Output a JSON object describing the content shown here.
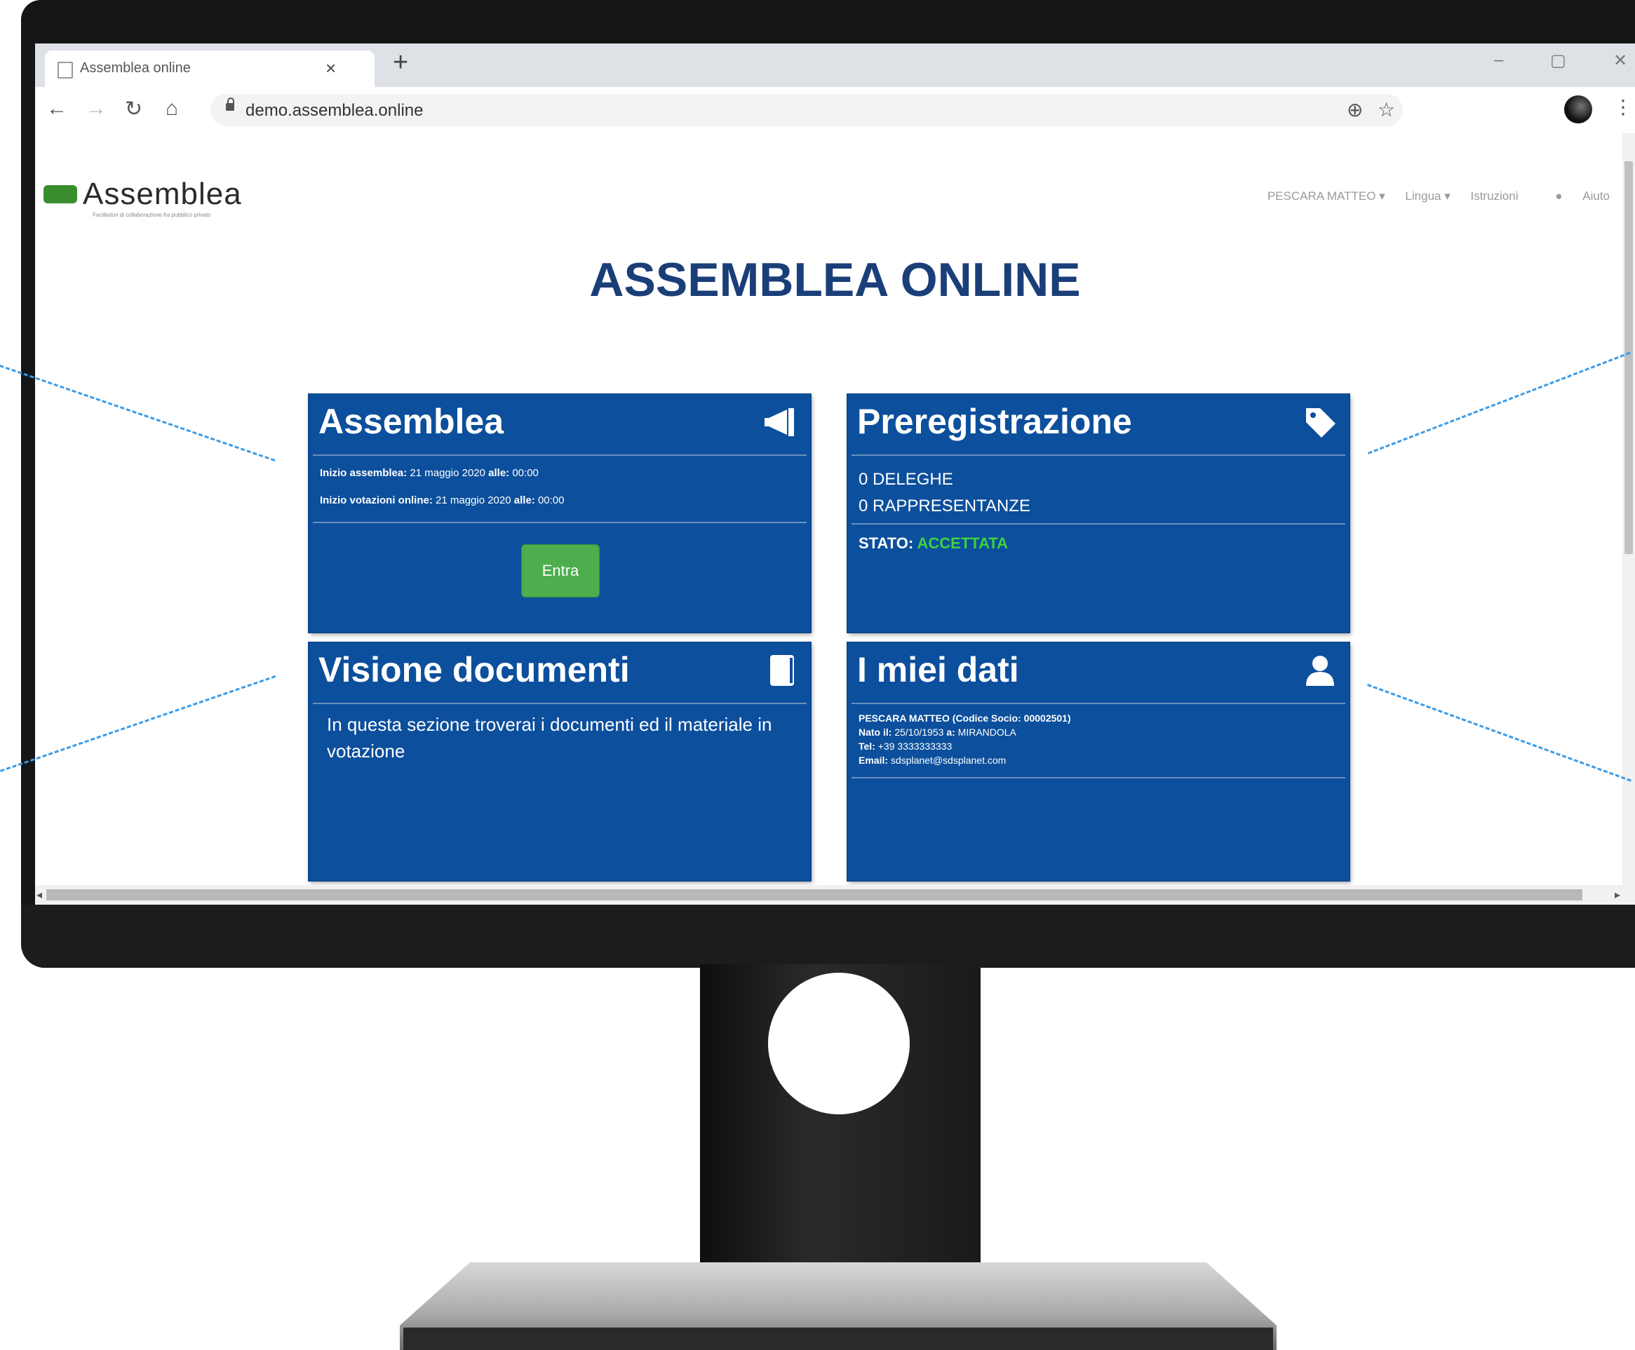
{
  "browser": {
    "tab_title": "Assemblea online",
    "tab_close": "×",
    "new_tab": "+",
    "url": "demo.assemblea.online",
    "icons": [
      "back-icon",
      "forward-icon",
      "reload-icon",
      "home-icon",
      "lock-icon",
      "zoom-icon",
      "star-icon",
      "avatar",
      "menu-icon"
    ]
  },
  "header": {
    "logo_text": "Assemblea",
    "logo_subtitle": "Facilitatori di collaborazione fra pubblico privato",
    "nav": {
      "user": "PESCARA MATTEO ▾",
      "lingua": "Lingua ▾",
      "istruzioni": "Istruzioni",
      "aiuto": "Aiuto"
    }
  },
  "page_title": "ASSEMBLEA ONLINE",
  "cards": {
    "assemblea": {
      "title": "Assemblea",
      "icon": "megaphone-icon",
      "inizio_label": "Inizio assemblea:",
      "inizio_date": "21 maggio 2020",
      "alle1_label": "alle:",
      "inizio_time": "00:00",
      "voto_label": "Inizio votazioni online:",
      "voto_date": "21 maggio 2020",
      "alle2_label": "alle:",
      "voto_time": "00:00",
      "button": "Entra"
    },
    "preregistrazione": {
      "title": "Preregistrazione",
      "icon": "tag-icon",
      "deleghe": "0 DELEGHE",
      "rappresentanze": "0 RAPPRESENTANZE",
      "stato_label": "STATO:",
      "stato_value": "ACCETTATA"
    },
    "documenti": {
      "title": "Visione documenti",
      "icon": "book-icon",
      "text": "In questa sezione troverai i documenti ed il materiale in votazione"
    },
    "dati": {
      "title": "I miei dati",
      "icon": "user-icon",
      "name_line": "PESCARA MATTEO (Codice Socio: 00002501)",
      "nato_label": "Nato il:",
      "nato_date": "25/10/1953",
      "a_label": "a:",
      "luogo": "MIRANDOLA",
      "tel_label": "Tel:",
      "tel": "+39 3333333333",
      "email_label": "Email:",
      "email": "sdsplanet@sdsplanet.com"
    }
  },
  "colors": {
    "card_blue": "#0c4f9c",
    "title_blue": "#1a3e78",
    "button_green": "#4cae4c",
    "status_green": "#3ed13e",
    "callout_blue": "#3a9be8"
  }
}
